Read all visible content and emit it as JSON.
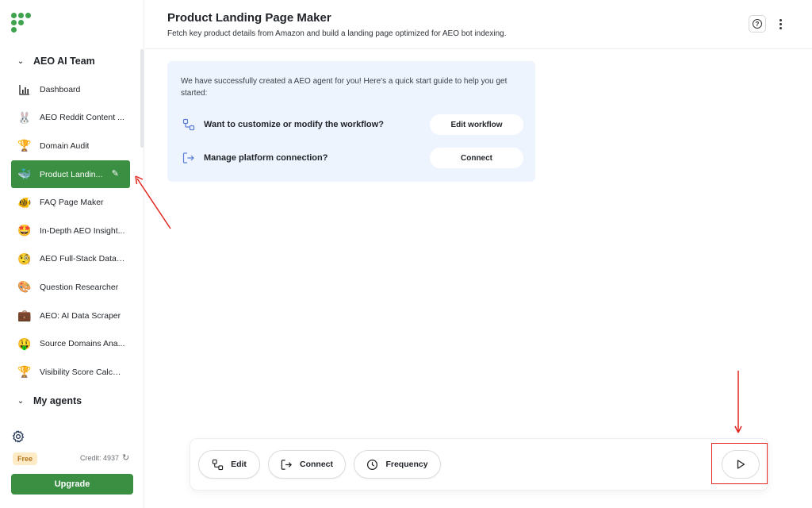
{
  "sidebar": {
    "section_team": "AEO AI Team",
    "items": [
      {
        "label": "Dashboard",
        "icon": "bar-chart-icon",
        "glyph": ""
      },
      {
        "label": "AEO Reddit Content ...",
        "icon": "rabbit-icon",
        "glyph": "🐰"
      },
      {
        "label": "Domain Audit",
        "icon": "trophy-icon",
        "glyph": "🏆"
      },
      {
        "label": "Product Landin...",
        "icon": "whale-icon",
        "glyph": "🐳",
        "active": true
      },
      {
        "label": "FAQ Page Maker",
        "icon": "fish-icon",
        "glyph": "🐠"
      },
      {
        "label": "In-Depth AEO Insight...",
        "icon": "star-struck-icon",
        "glyph": "🤩"
      },
      {
        "label": "AEO Full-Stack Data ...",
        "icon": "monocle-face-icon",
        "glyph": "🧐"
      },
      {
        "label": "Question Researcher",
        "icon": "palette-icon",
        "glyph": "🎨"
      },
      {
        "label": "AEO: AI Data Scraper",
        "icon": "briefcase-icon",
        "glyph": "💼"
      },
      {
        "label": "Source Domains Ana...",
        "icon": "money-face-icon",
        "glyph": "🤑"
      },
      {
        "label": "Visibility Score Calcul...",
        "icon": "trophy-icon",
        "glyph": "🏆"
      }
    ],
    "section_agents": "My agents",
    "plan_badge": "Free",
    "credit_text": "Credit: 4937",
    "upgrade_label": "Upgrade"
  },
  "header": {
    "title": "Product Landing Page Maker",
    "subtitle": "Fetch key product details from Amazon and build a landing page optimized for AEO bot indexing."
  },
  "quickstart": {
    "intro": "We have successfully created a AEO agent for you! Here's a quick start guide to help you get started:",
    "customize_question": "Want to customize or modify the workflow?",
    "customize_button": "Edit workflow",
    "connect_question": "Manage platform connection?",
    "connect_button": "Connect"
  },
  "toolbar": {
    "edit_label": "Edit",
    "connect_label": "Connect",
    "frequency_label": "Frequency"
  },
  "colors": {
    "brand_green": "#3a8f43",
    "card_bg": "#eef4fe",
    "annotation_red": "#e2261f",
    "badge_bg": "#fdebc8"
  }
}
